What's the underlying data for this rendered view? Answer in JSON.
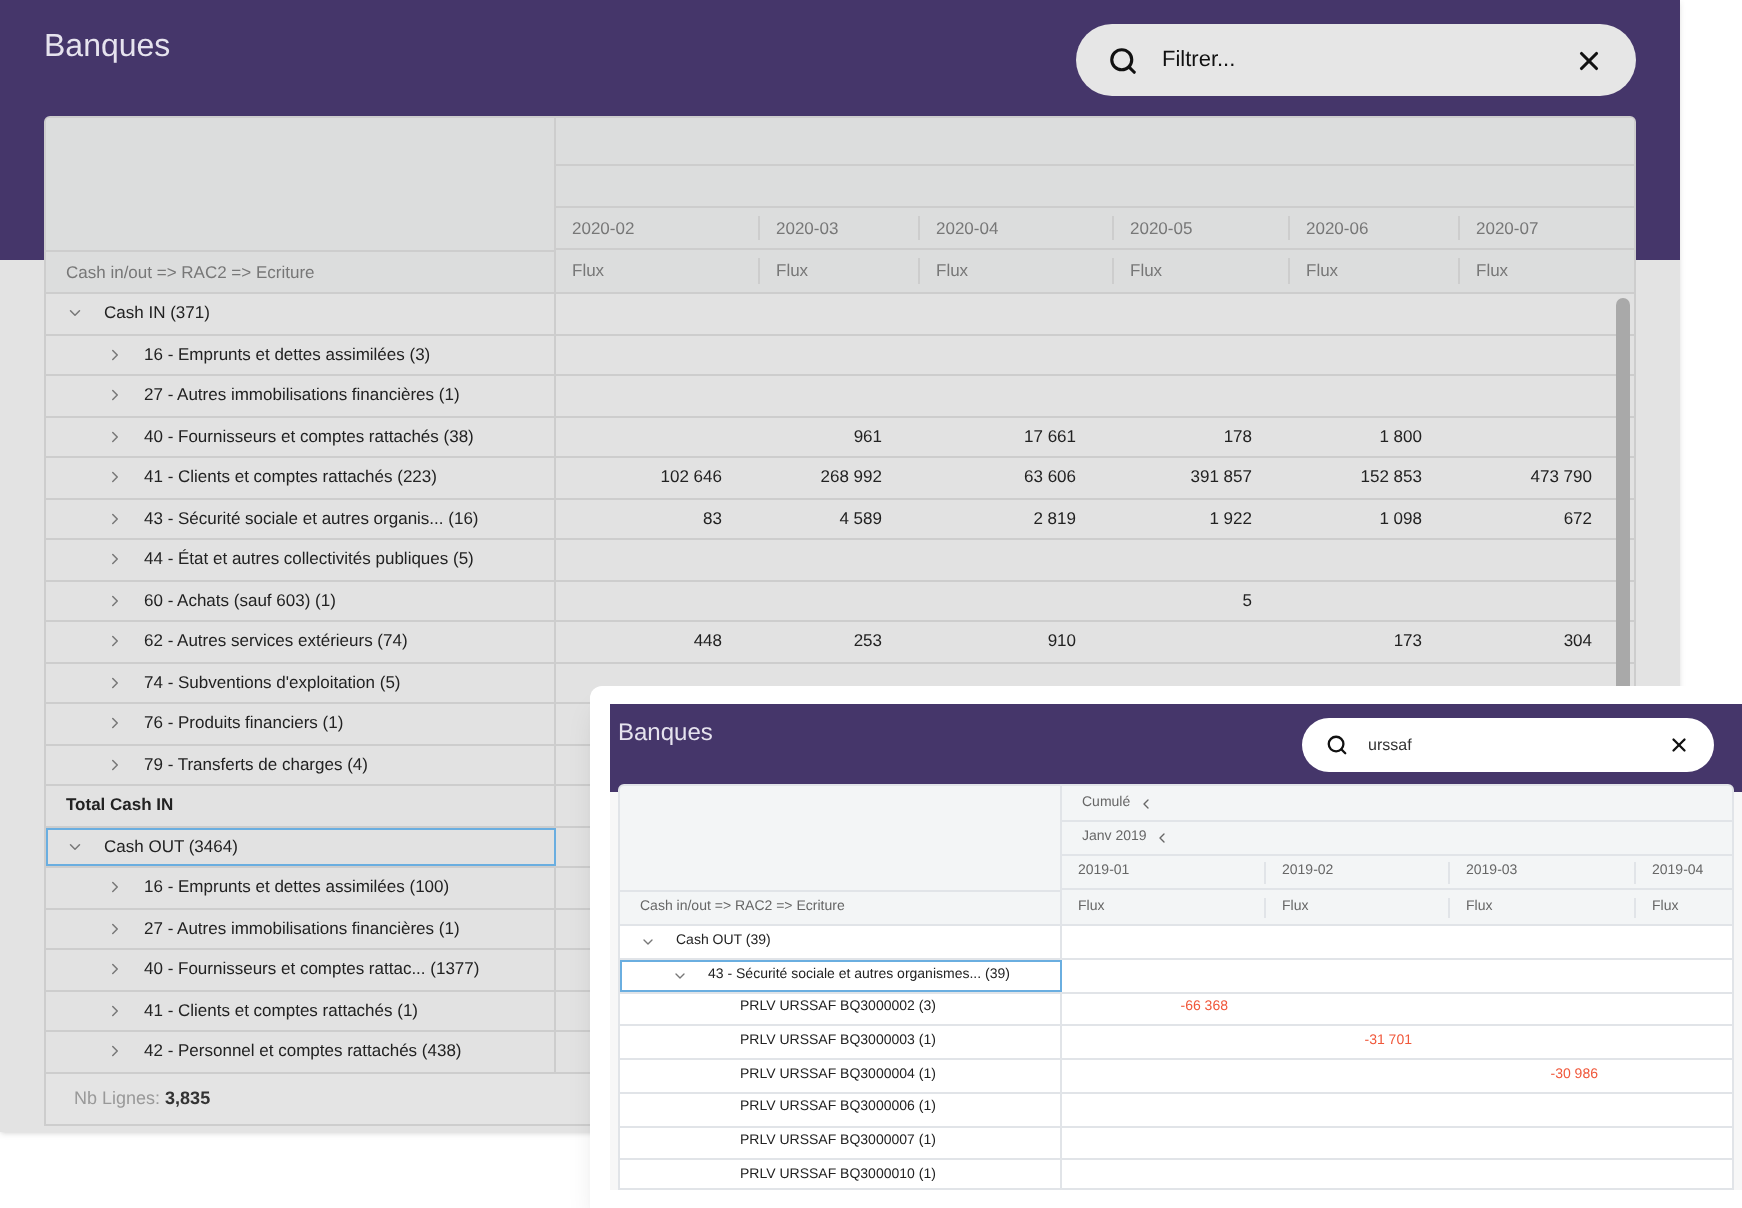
{
  "main": {
    "title": "Banques",
    "search": {
      "placeholder": "Filtrer..."
    },
    "table": {
      "corner_header": "Cash in/out => RAC2 => Ecriture",
      "columns": [
        {
          "period": "2020-02",
          "measure": "Flux"
        },
        {
          "period": "2020-03",
          "measure": "Flux"
        },
        {
          "period": "2020-04",
          "measure": "Flux"
        },
        {
          "period": "2020-05",
          "measure": "Flux"
        },
        {
          "period": "2020-06",
          "measure": "Flux"
        },
        {
          "period": "2020-07",
          "measure": "Flux"
        }
      ],
      "rows": [
        {
          "kind": "group",
          "label": "Cash IN (371)",
          "expanded": true,
          "selected": false,
          "children": [
            {
              "kind": "group",
              "label": "16 - Emprunts et dettes assimilées (3)",
              "expanded": false,
              "selected": false
            },
            {
              "kind": "group",
              "label": "27 - Autres immobilisations financières (1)",
              "expanded": false,
              "selected": false
            },
            {
              "kind": "group",
              "label": "40 - Fournisseurs et comptes rattachés (38)",
              "expanded": false,
              "selected": false,
              "values": {
                "c1": "961",
                "c2": "17 661",
                "c3": "178",
                "c4": "1 800"
              }
            },
            {
              "kind": "group",
              "label": "41 - Clients et comptes rattachés (223)",
              "expanded": false,
              "selected": false,
              "values": {
                "c0": "102 646",
                "c1": "268 992",
                "c2": "63 606",
                "c3": "391 857",
                "c4": "152 853",
                "c5": "473 790"
              }
            },
            {
              "kind": "group",
              "label": "43 - Sécurité sociale et autres organis...  (16)",
              "expanded": false,
              "selected": false,
              "values": {
                "c0": "83",
                "c1": "4 589",
                "c2": "2 819",
                "c3": "1 922",
                "c4": "1 098",
                "c5": "672"
              }
            },
            {
              "kind": "group",
              "label": "44 - État et autres collectivités publiques (5)",
              "expanded": false,
              "selected": false
            },
            {
              "kind": "group",
              "label": "60 - Achats (sauf 603) (1)",
              "expanded": false,
              "selected": false,
              "values": {
                "c3": "5"
              }
            },
            {
              "kind": "group",
              "label": "62 - Autres services extérieurs (74)",
              "expanded": false,
              "selected": false,
              "values": {
                "c0": "448",
                "c1": "253",
                "c2": "910",
                "c4": "173",
                "c5": "304"
              }
            },
            {
              "kind": "group",
              "label": "74 - Subventions d'exploitation (5)",
              "expanded": false,
              "selected": false
            },
            {
              "kind": "group",
              "label": "76 - Produits financiers (1)",
              "expanded": false,
              "selected": false
            },
            {
              "kind": "group",
              "label": "79 - Transferts de charges (4)",
              "expanded": false,
              "selected": false
            }
          ]
        },
        {
          "kind": "total",
          "label": "Total Cash IN",
          "selected": false
        },
        {
          "kind": "group",
          "label": "Cash OUT (3464)",
          "expanded": true,
          "selected": true,
          "children": [
            {
              "kind": "group",
              "label": "16 - Emprunts et dettes assimilées (100)",
              "expanded": false,
              "selected": false
            },
            {
              "kind": "group",
              "label": "27 - Autres immobilisations financières (1)",
              "expanded": false,
              "selected": false
            },
            {
              "kind": "group",
              "label": "40 - Fournisseurs et comptes rattac... (1377)",
              "expanded": false,
              "selected": false
            },
            {
              "kind": "group",
              "label": "41 - Clients et comptes rattachés (1)",
              "expanded": false,
              "selected": false
            },
            {
              "kind": "group",
              "label": "42 - Personnel et comptes rattachés (438)",
              "expanded": false,
              "selected": false
            }
          ]
        }
      ]
    },
    "footer": {
      "label": "Nb Lignes:",
      "value": "3,835"
    }
  },
  "overlay": {
    "title": "Banques",
    "search": {
      "value": "urssaf"
    },
    "table": {
      "corner_header": "Cash in/out => RAC2 => Ecriture",
      "header_groups": [
        {
          "label": "Cumulé"
        },
        {
          "label": "Janv 2019"
        }
      ],
      "columns": [
        {
          "period": "2019-01",
          "measure": "Flux"
        },
        {
          "period": "2019-02",
          "measure": "Flux"
        },
        {
          "period": "2019-03",
          "measure": "Flux"
        },
        {
          "period": "2019-04",
          "measure": "Flux"
        }
      ],
      "rows": [
        {
          "kind": "group",
          "label": "Cash OUT (39)",
          "expanded": true,
          "selected": false,
          "children": [
            {
              "kind": "group",
              "label": "43 - Sécurité sociale et autres organismes... (39)",
              "expanded": true,
              "selected": true,
              "children": [
                {
                  "kind": "entry",
                  "label": "PRLV URSSAF BQ3000002 (3)",
                  "selected": false,
                  "values": {
                    "c0": "-66 368"
                  }
                },
                {
                  "kind": "entry",
                  "label": "PRLV URSSAF BQ3000003 (1)",
                  "selected": false,
                  "values": {
                    "c1": "-31 701"
                  }
                },
                {
                  "kind": "entry",
                  "label": "PRLV URSSAF BQ3000004 (1)",
                  "selected": false,
                  "values": {
                    "c2": "-30 986"
                  }
                },
                {
                  "kind": "entry",
                  "label": "PRLV URSSAF BQ3000006 (1)",
                  "selected": false
                },
                {
                  "kind": "entry",
                  "label": "PRLV URSSAF BQ3000007 (1)",
                  "selected": false
                },
                {
                  "kind": "entry",
                  "label": "PRLV URSSAF BQ3000010 (1)",
                  "selected": false
                }
              ]
            }
          ]
        }
      ]
    }
  }
}
